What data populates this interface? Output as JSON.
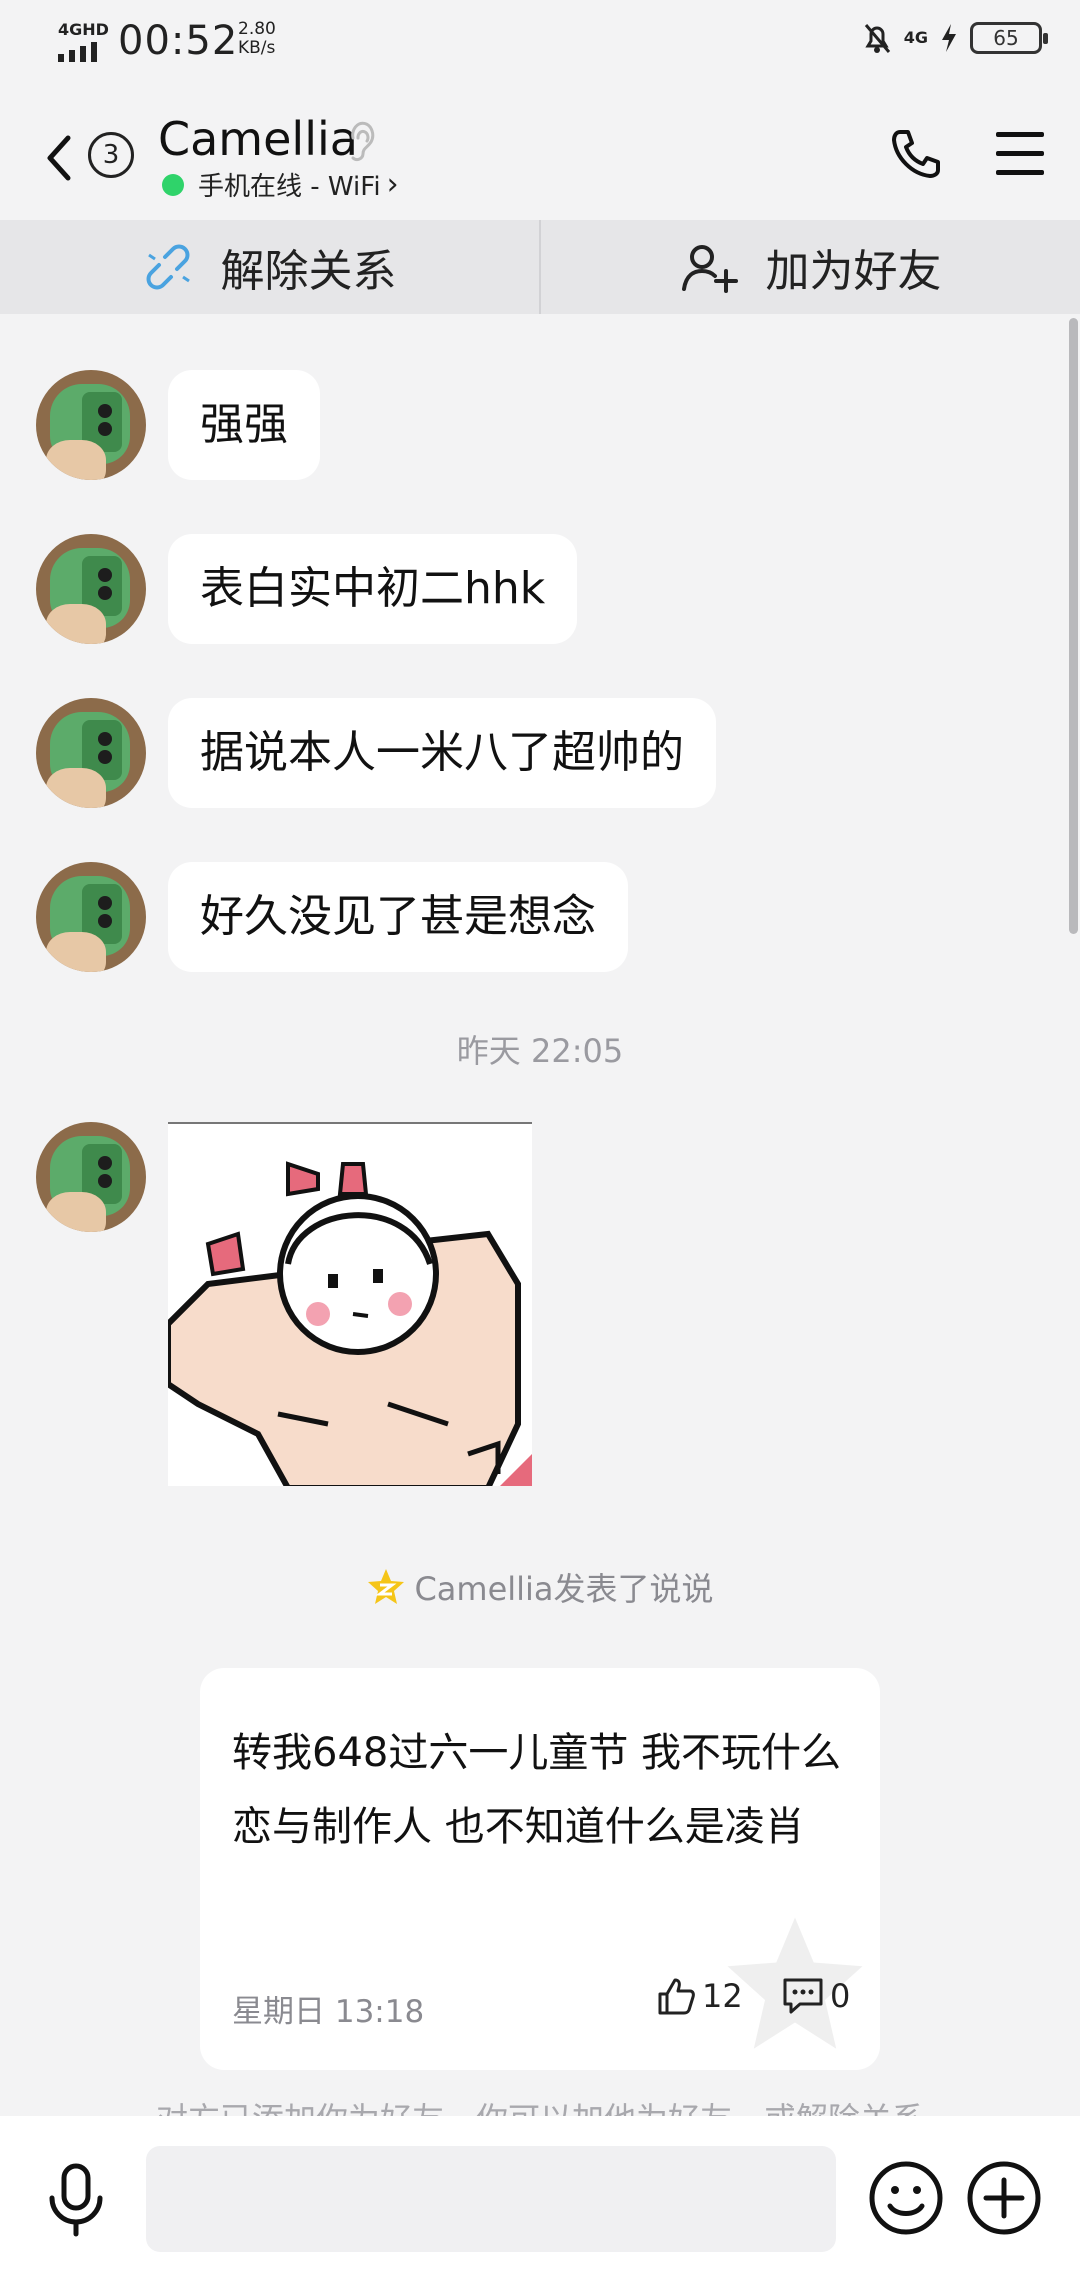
{
  "status_bar": {
    "network": "4GHD",
    "time": "00:52",
    "speed_value": "2.80",
    "speed_unit": "KB/s",
    "network_right": "4G",
    "battery": "65"
  },
  "header": {
    "unread_count": "3",
    "contact_name": "Camellia",
    "status": "手机在线 - WiFi",
    "status_chevron": "›"
  },
  "actions": {
    "remove_label": "解除关系",
    "add_label": "加为好友"
  },
  "messages": [
    {
      "text": "强强"
    },
    {
      "text": "表白实中初二hhk"
    },
    {
      "text": "据说本人一米八了超帅的"
    },
    {
      "text": "好久没见了甚是想念"
    }
  ],
  "timestamp": "昨天 22:05",
  "qzone_note": "Camellia发表了说说",
  "feed": {
    "text": "转我648过六一儿童节 我不玩什么恋与制作人 也不知道什么是凌肖",
    "time": "星期日 13:18",
    "likes": "12",
    "comments": "0"
  },
  "hint": "对方已添加你为好友，你可以加他为好友，或解除关系",
  "icons": {
    "back": "chevron-left-icon",
    "ear": "ear-icon",
    "phone": "phone-icon",
    "menu": "menu-icon",
    "unlink": "unlink-icon",
    "add_user": "add-user-icon",
    "qzone": "qzone-star-icon",
    "like": "thumbs-up-icon",
    "comment": "comment-icon",
    "mic": "microphone-icon",
    "emoji": "emoji-icon",
    "plus": "plus-icon"
  },
  "colors": {
    "online": "#2fd36a",
    "background": "#f3f3f4",
    "bubble": "#ffffff",
    "unlink_icon": "#4aa3e0",
    "qzone_star": "#f5c518"
  }
}
